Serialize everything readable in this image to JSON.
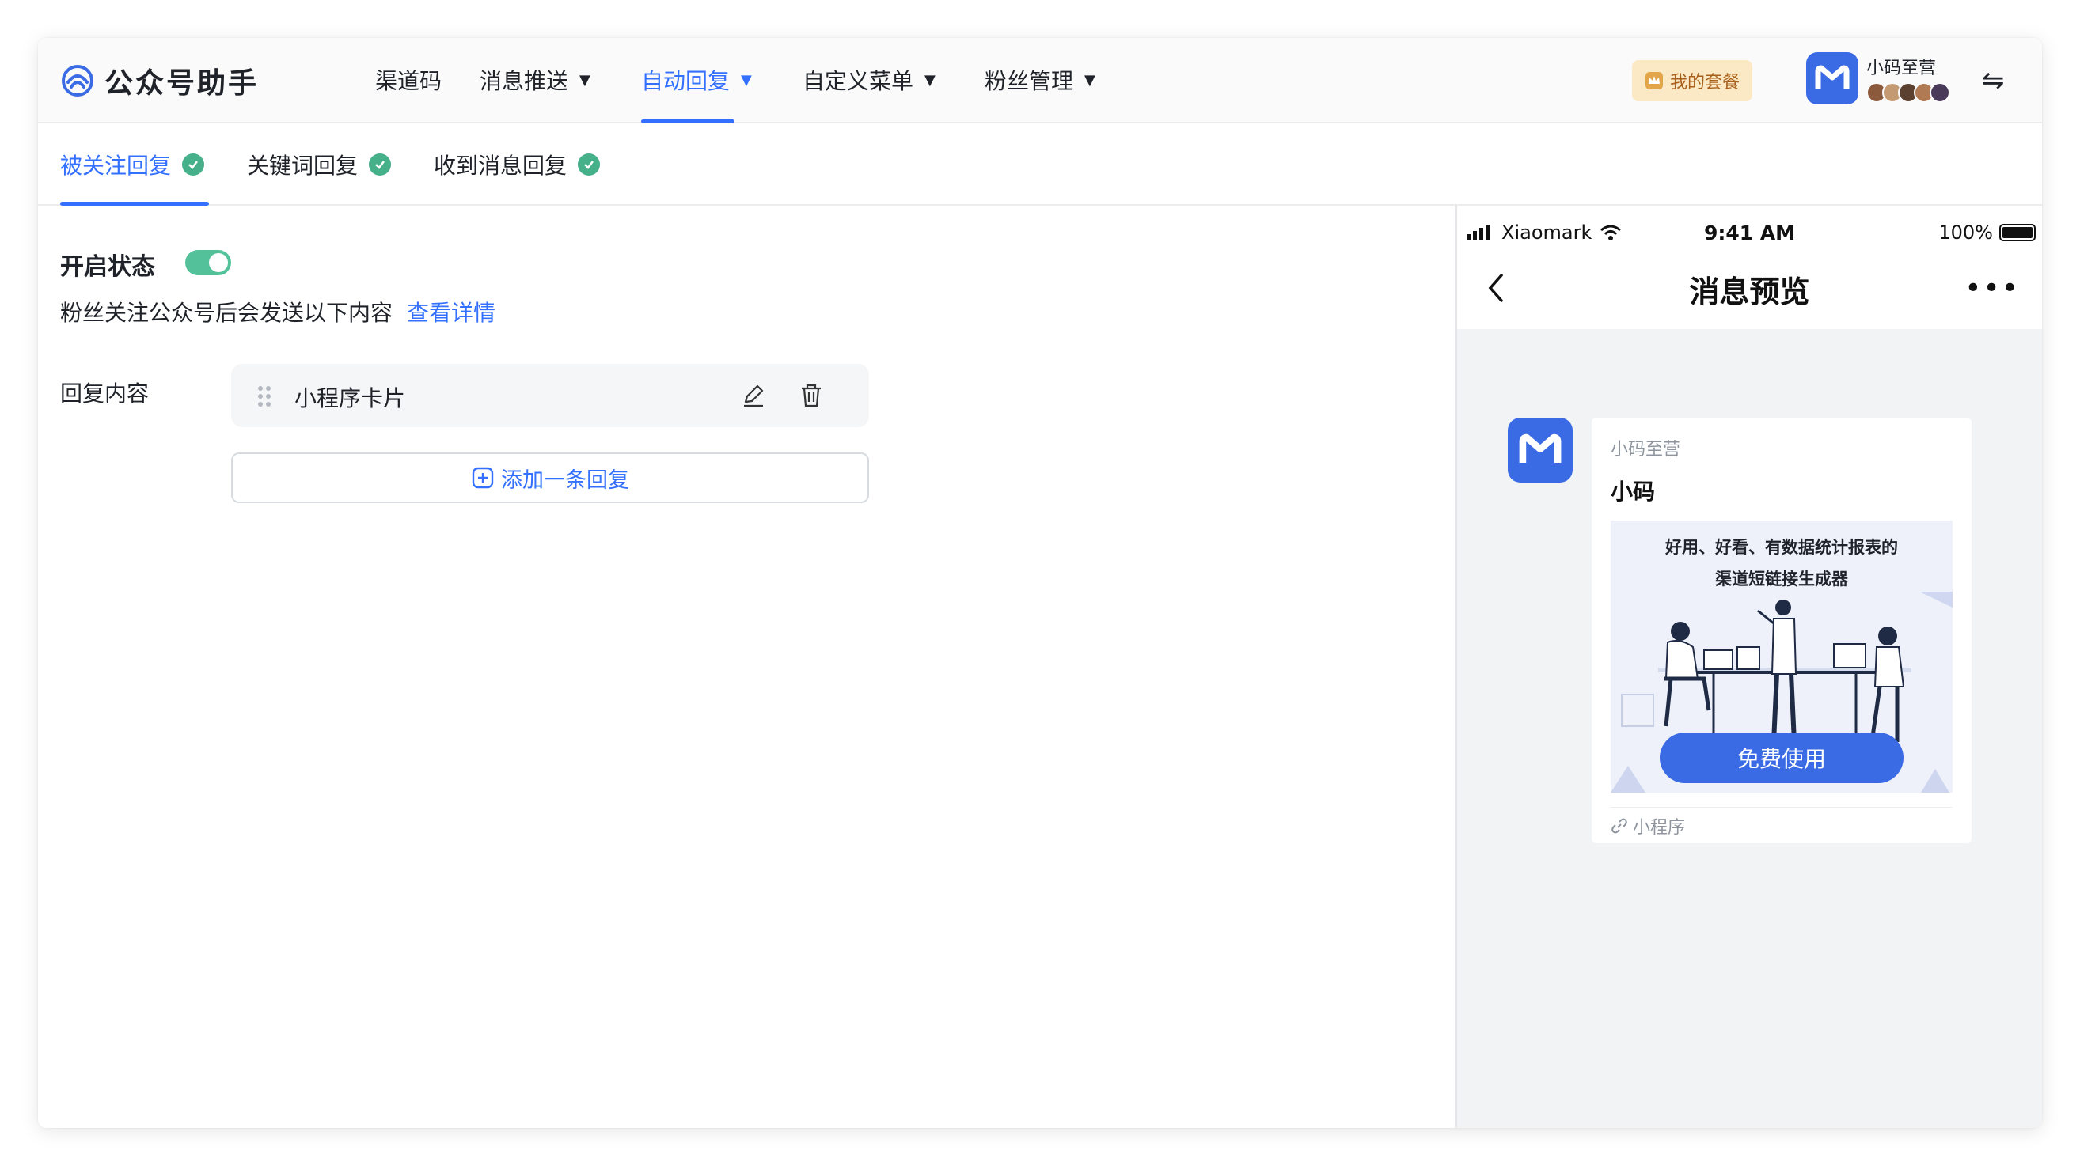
{
  "app": {
    "title": "公众号助手"
  },
  "nav": {
    "items": [
      {
        "label": "渠道码",
        "has_caret": false,
        "active": false
      },
      {
        "label": "消息推送",
        "has_caret": true,
        "active": false
      },
      {
        "label": "自动回复",
        "has_caret": true,
        "active": true
      },
      {
        "label": "自定义菜单",
        "has_caret": true,
        "active": false
      },
      {
        "label": "粉丝管理",
        "has_caret": true,
        "active": false
      }
    ],
    "caret_icon": "caret-down-icon",
    "plan_label": "我的套餐",
    "account_name": "小码至营",
    "switch_icon": "⇋"
  },
  "subtabs": [
    {
      "label": "被关注回复",
      "active": true
    },
    {
      "label": "关键词回复",
      "active": false
    },
    {
      "label": "收到消息回复",
      "active": false
    }
  ],
  "main": {
    "status_label": "开启状态",
    "status_enabled": true,
    "description": "粉丝关注公众号后会发送以下内容",
    "details_link": "查看详情",
    "reply_label": "回复内容",
    "reply_item": "小程序卡片",
    "add_reply": "添加一条回复"
  },
  "preview": {
    "carrier": "Xiaomark",
    "time": "9:41 AM",
    "battery": "100%",
    "title": "消息预览",
    "more": "•••",
    "sender": "小码至营",
    "message_title": "小码",
    "card_caption_line1": "好用、好看、有数据统计报表的",
    "card_caption_line2": "渠道短链接生成器",
    "card_button": "免费使用",
    "footer": "小程序"
  },
  "colors": {
    "accent": "#3370ff",
    "success": "#45b08a",
    "toggle_on": "#53c29a",
    "brand_avatar": "#3a6be5",
    "plan_bg": "#fbe9c6",
    "plan_text": "#a9601a"
  }
}
